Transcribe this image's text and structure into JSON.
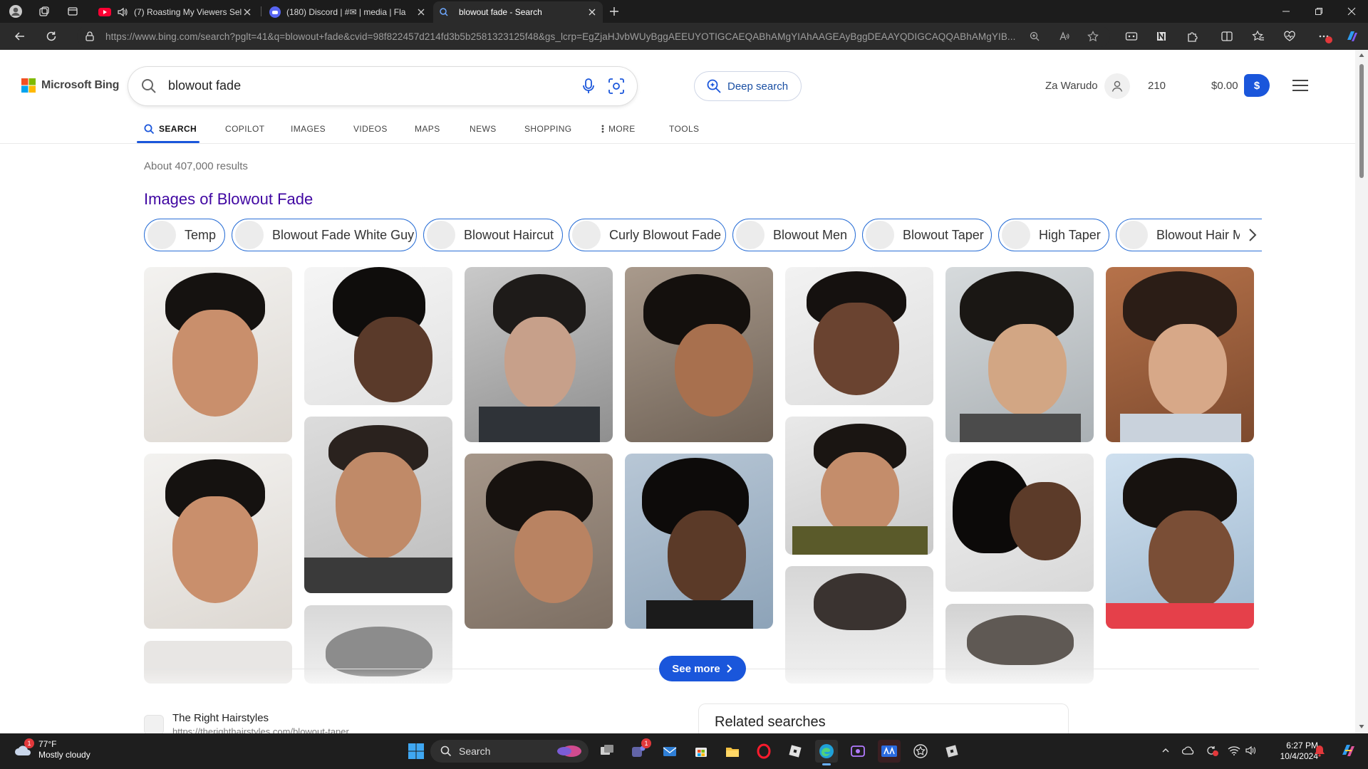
{
  "browser": {
    "tabs": [
      {
        "title": "(7) Roasting My Viewers Sel"
      },
      {
        "title": "(180) Discord | #✉ | media | Fla"
      },
      {
        "title": "blowout fade - Search"
      }
    ],
    "url_host": "https://www.bing.com",
    "url_path": "/search?pglt=41&q=blowout+fade&cvid=98f822457d214fd3b5b2581323125f48&gs_lcrp=EgZjaHJvbWUyBggAEEUYOTIGCAEQABhAMgYIAhAAGEAyBggDEAAYQDIGCAQQABhAMgYIB..."
  },
  "bing": {
    "logo_text": "Microsoft Bing",
    "search_value": "blowout fade",
    "deep_search_label": "Deep search",
    "user_name": "Za Warudo",
    "points": "210",
    "rewards_balance": "$0.00",
    "rewards_badge": "$",
    "nav": [
      {
        "label": "SEARCH"
      },
      {
        "label": "COPILOT"
      },
      {
        "label": "IMAGES"
      },
      {
        "label": "VIDEOS"
      },
      {
        "label": "MAPS"
      },
      {
        "label": "NEWS"
      },
      {
        "label": "SHOPPING"
      },
      {
        "label": "MORE"
      },
      {
        "label": "TOOLS"
      }
    ],
    "results_count": "About 407,000 results",
    "images_heading": "Images of Blowout Fade",
    "chips": [
      {
        "label": "Temp"
      },
      {
        "label": "Blowout Fade White Guy"
      },
      {
        "label": "Blowout Haircut"
      },
      {
        "label": "Curly Blowout Fade"
      },
      {
        "label": "Blowout Men"
      },
      {
        "label": "Blowout Taper"
      },
      {
        "label": "High Taper"
      },
      {
        "label": "Blowout Hair Me"
      }
    ],
    "see_more_label": "See more",
    "result_site": "The Right Hairstyles",
    "result_url": "https://therighthairstyles.com/blowout-taper",
    "related_title": "Related searches"
  },
  "taskbar": {
    "weather_temp": "77°F",
    "weather_desc": "Mostly cloudy",
    "weather_badge": "1",
    "search_label": "Search",
    "teams_badge": "1",
    "time": "6:27 PM",
    "date": "10/4/2024"
  },
  "colors": {
    "accent": "#1a56db",
    "heading_purple": "#4007a2",
    "chrome_dark": "#1c1c1c"
  }
}
